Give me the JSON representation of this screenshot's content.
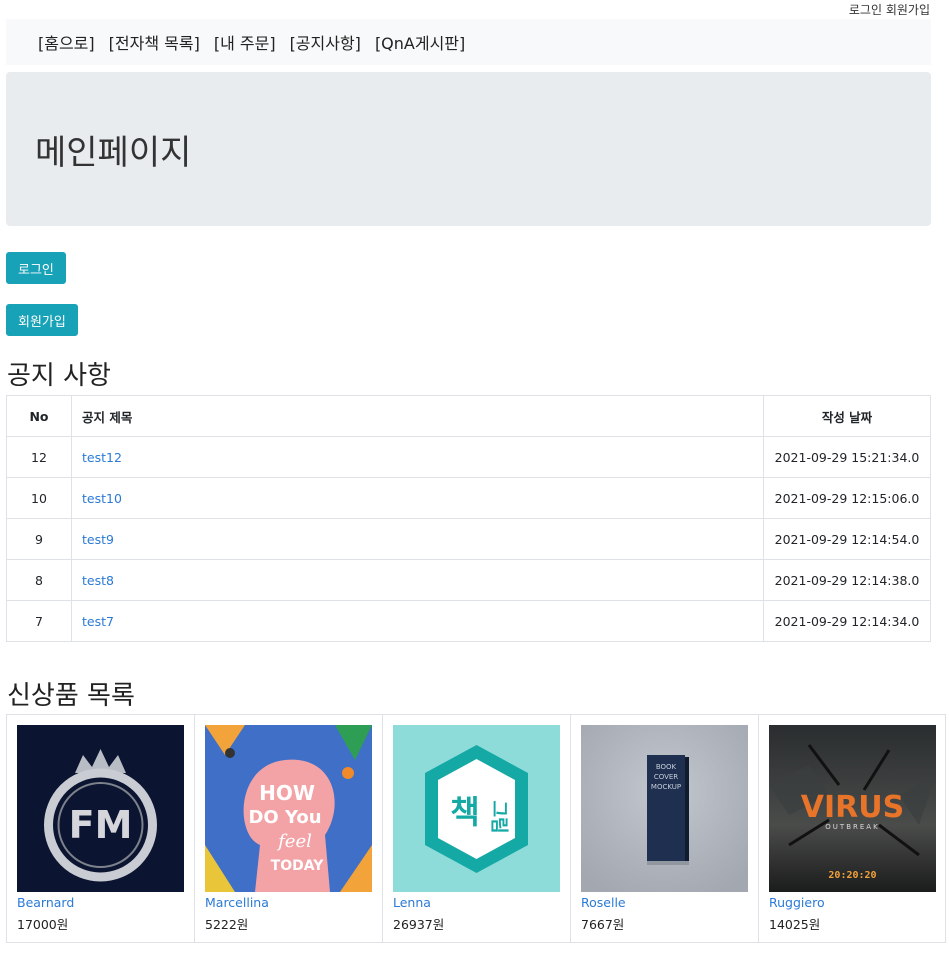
{
  "toplinks": {
    "login": "로그인",
    "signup": "회원가입"
  },
  "nav": {
    "items": [
      {
        "label": "[홈으로]"
      },
      {
        "label": "[전자책 목록]"
      },
      {
        "label": "[내 주문]"
      },
      {
        "label": "[공지사항]"
      },
      {
        "label": "[QnA게시판]"
      }
    ]
  },
  "jumbotron": {
    "title": "메인페이지"
  },
  "buttons": {
    "login": "로그인",
    "signup": "회원가입"
  },
  "notice": {
    "title": "공지 사항",
    "headers": {
      "no": "No",
      "title": "공지 제목",
      "date": "작성 날짜"
    },
    "rows": [
      {
        "no": "12",
        "title": "test12",
        "date": "2021-09-29 15:21:34.0"
      },
      {
        "no": "10",
        "title": "test10",
        "date": "2021-09-29 12:15:06.0"
      },
      {
        "no": "9",
        "title": "test9",
        "date": "2021-09-29 12:14:54.0"
      },
      {
        "no": "8",
        "title": "test8",
        "date": "2021-09-29 12:14:38.0"
      },
      {
        "no": "7",
        "title": "test7",
        "date": "2021-09-29 12:14:34.0"
      }
    ]
  },
  "products": {
    "title": "신상품 목록",
    "items": [
      {
        "name": "Bearnard",
        "price": "17000원",
        "cover_text": "FM"
      },
      {
        "name": "Marcellina",
        "price": "5222원",
        "cover_text": "HOW DO You Feel TODAY"
      },
      {
        "name": "Lenna",
        "price": "26937원",
        "cover_text": "책그림"
      },
      {
        "name": "Roselle",
        "price": "7667원",
        "cover_text": "BOOK COVER MOCKUP"
      },
      {
        "name": "Ruggiero",
        "price": "14025원",
        "cover_text": "VIRUS OUTBREAK 20:20:20"
      }
    ]
  }
}
